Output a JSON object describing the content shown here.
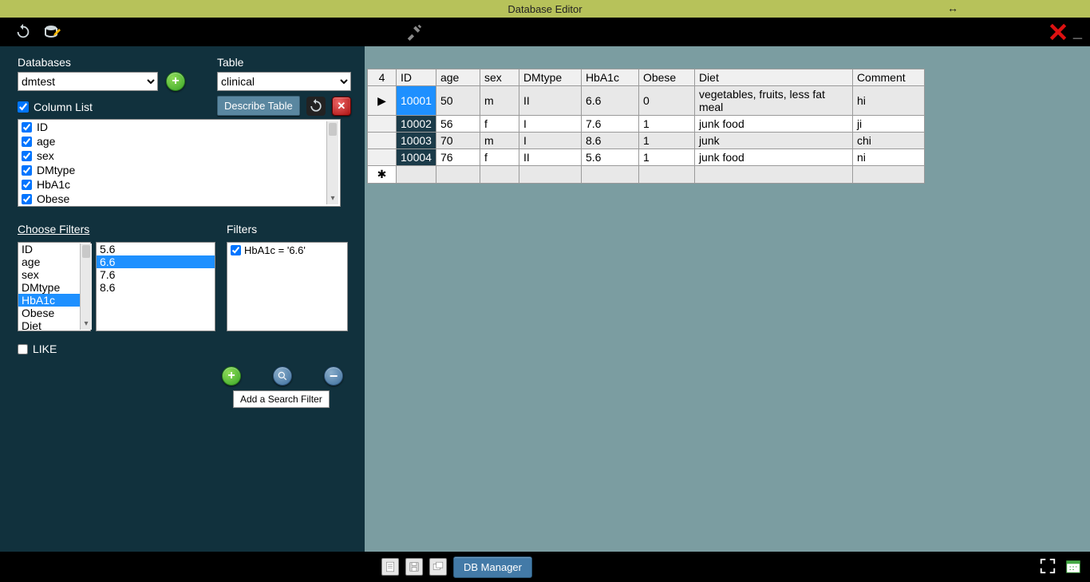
{
  "title": "Database Editor",
  "sidebar": {
    "databases_label": "Databases",
    "database_selected": "dmtest",
    "table_label": "Table",
    "table_selected": "clinical",
    "describe_button": "Describe Table",
    "column_list_label": "Column List",
    "columns": [
      {
        "name": "ID",
        "checked": true
      },
      {
        "name": "age",
        "checked": true
      },
      {
        "name": "sex",
        "checked": true
      },
      {
        "name": "DMtype",
        "checked": true
      },
      {
        "name": "HbA1c",
        "checked": true
      },
      {
        "name": "Obese",
        "checked": true
      }
    ],
    "choose_filters_label": "Choose Filters",
    "filters_label": "Filters",
    "filter_fields": [
      "ID",
      "age",
      "sex",
      "DMtype",
      "HbA1c",
      "Obese",
      "Diet"
    ],
    "filter_field_selected": "HbA1c",
    "filter_values": [
      "5.6",
      "6.6",
      "7.6",
      "8.6"
    ],
    "filter_value_selected": "6.6",
    "applied_filters": [
      {
        "text": "HbA1c = '6.6'",
        "checked": true
      }
    ],
    "like_label": "LIKE",
    "tooltip_add_filter": "Add a Search Filter"
  },
  "grid": {
    "row_count_header": "4",
    "columns": [
      "ID",
      "age",
      "sex",
      "DMtype",
      "HbA1c",
      "Obese",
      "Diet",
      "Comment"
    ],
    "selected_row": 0,
    "rows": [
      {
        "ID": "10001",
        "age": "50",
        "sex": "m",
        "DMtype": "II",
        "HbA1c": "6.6",
        "Obese": "0",
        "Diet": "vegetables, fruits, less fat meal",
        "Comment": "hi"
      },
      {
        "ID": "10002",
        "age": "56",
        "sex": "f",
        "DMtype": "I",
        "HbA1c": "7.6",
        "Obese": "1",
        "Diet": "junk food",
        "Comment": "ji"
      },
      {
        "ID": "10003",
        "age": "70",
        "sex": "m",
        "DMtype": "I",
        "HbA1c": "8.6",
        "Obese": "1",
        "Diet": "junk",
        "Comment": "chi"
      },
      {
        "ID": "10004",
        "age": "76",
        "sex": "f",
        "DMtype": "II",
        "HbA1c": "5.6",
        "Obese": "1",
        "Diet": "junk food",
        "Comment": "ni"
      }
    ]
  },
  "taskbar": {
    "db_manager": "DB Manager"
  }
}
